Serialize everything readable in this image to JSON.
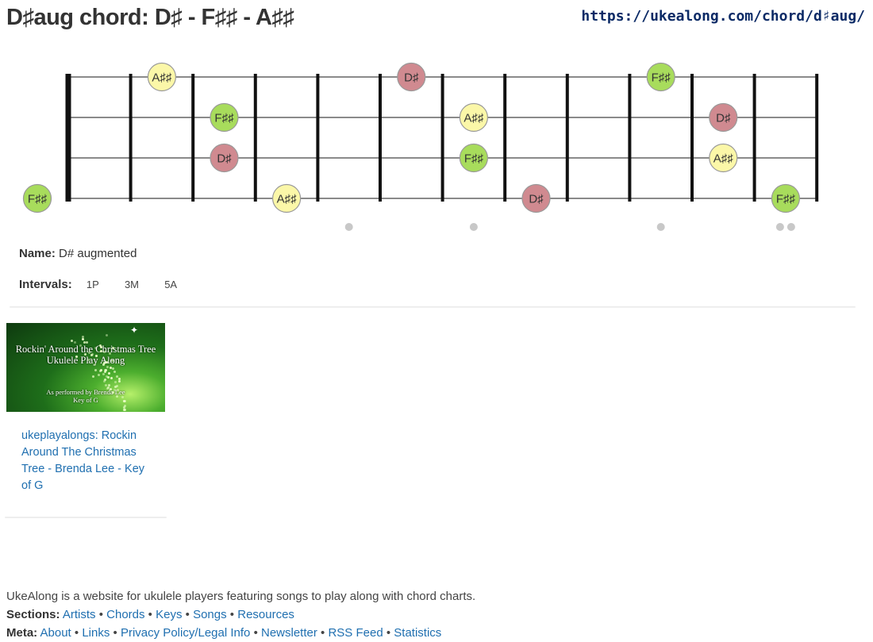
{
  "page": {
    "title": "D♯aug chord: D♯ - F♯♯ - A♯♯",
    "url": "https://ukealong.com/chord/d♯aug/"
  },
  "fretboard": {
    "strings": 4,
    "frets": 12,
    "fret_markers": [
      5,
      7,
      10,
      12
    ],
    "note_colors": {
      "D♯": "#d08a90",
      "F♯♯": "#a8dc5c",
      "A♯♯": "#fbf7a8"
    },
    "notes": [
      {
        "string": 1,
        "fret": 2,
        "label": "A♯♯"
      },
      {
        "string": 1,
        "fret": 6,
        "label": "D♯"
      },
      {
        "string": 1,
        "fret": 10,
        "label": "F♯♯"
      },
      {
        "string": 2,
        "fret": 3,
        "label": "F♯♯"
      },
      {
        "string": 2,
        "fret": 7,
        "label": "A♯♯"
      },
      {
        "string": 2,
        "fret": 11,
        "label": "D♯"
      },
      {
        "string": 3,
        "fret": 3,
        "label": "D♯"
      },
      {
        "string": 3,
        "fret": 7,
        "label": "F♯♯"
      },
      {
        "string": 3,
        "fret": 11,
        "label": "A♯♯"
      },
      {
        "string": 4,
        "fret": 0,
        "label": "F♯♯"
      },
      {
        "string": 4,
        "fret": 4,
        "label": "A♯♯"
      },
      {
        "string": 4,
        "fret": 8,
        "label": "D♯"
      },
      {
        "string": 4,
        "fret": 12,
        "label": "F♯♯"
      }
    ]
  },
  "info": {
    "name_label": "Name:",
    "name_value": "D# augmented",
    "intervals_label": "Intervals:",
    "intervals": [
      "1P",
      "3M",
      "5A"
    ]
  },
  "video": {
    "thumb_title_line1": "Rockin' Around the Christmas Tree",
    "thumb_title_line2": "Ukulele Play Along",
    "thumb_sub_line1": "As performed by Brenda Lee",
    "thumb_sub_line2": "Key of G",
    "link_text": "ukeplayalongs: Rockin Around The Christmas Tree - Brenda Lee - Key of G"
  },
  "footer": {
    "description": "UkeAlong is a website for ukulele players featuring songs to play along with chord charts.",
    "sections_label": "Sections:",
    "sections": [
      "Artists",
      "Chords",
      "Keys",
      "Songs",
      "Resources"
    ],
    "meta_label": "Meta:",
    "meta": [
      "About",
      "Links",
      "Privacy Policy/Legal Info",
      "Newsletter",
      "RSS Feed",
      "Statistics"
    ]
  }
}
